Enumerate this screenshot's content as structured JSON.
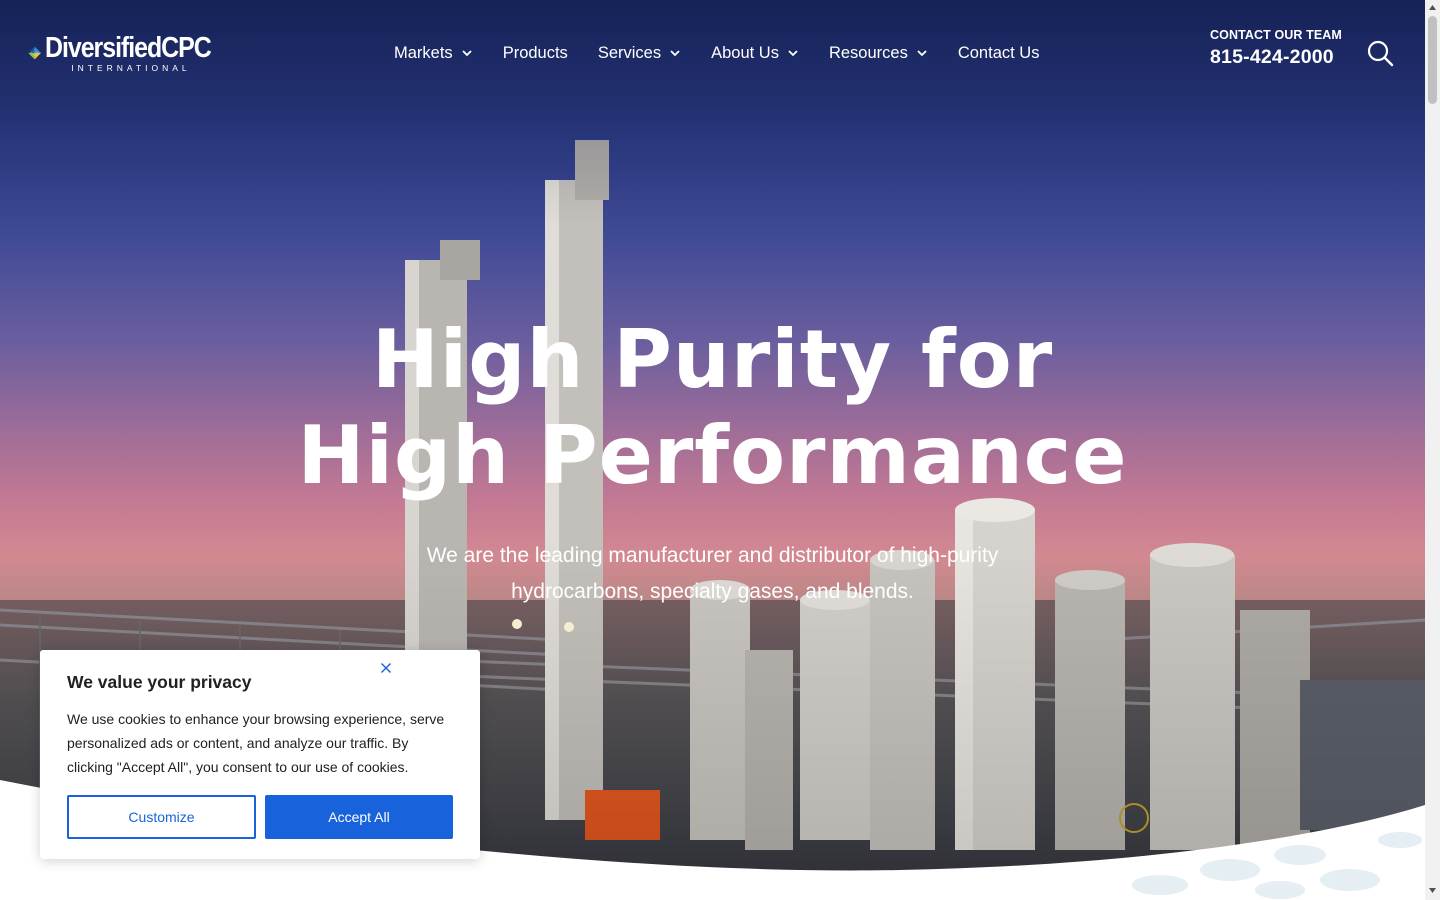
{
  "brand": {
    "name": "DiversifiedCPC",
    "tagline": "INTERNATIONAL"
  },
  "nav": {
    "items": [
      {
        "label": "Markets",
        "has_dropdown": true
      },
      {
        "label": "Products",
        "has_dropdown": false
      },
      {
        "label": "Services",
        "has_dropdown": true
      },
      {
        "label": "About Us",
        "has_dropdown": true
      },
      {
        "label": "Resources",
        "has_dropdown": true
      },
      {
        "label": "Contact Us",
        "has_dropdown": false
      }
    ]
  },
  "contact": {
    "label": "CONTACT OUR TEAM",
    "phone": "815-424-2000"
  },
  "hero": {
    "title_line1": "High Purity for",
    "title_line2": "High Performance",
    "subtitle_line1": "We are the leading manufacturer and distributor of high-purity",
    "subtitle_line2": "hydrocarbons, specialty gases, and blends."
  },
  "cookie_banner": {
    "title": "We value your privacy",
    "text": "We use cookies to enhance your browsing experience, serve personalized ads or content, and analyze our traffic. By clicking \"Accept All\", you consent to our use of cookies.",
    "customize_label": "Customize",
    "accept_label": "Accept All"
  },
  "colors": {
    "accent": "#1863dc",
    "text_dark": "#212121",
    "hero_top": "#1c2a66",
    "hero_pink": "#d38a91"
  },
  "icons": {
    "search": "search-icon",
    "close": "close-icon",
    "chevron": "chevron-down-icon"
  }
}
